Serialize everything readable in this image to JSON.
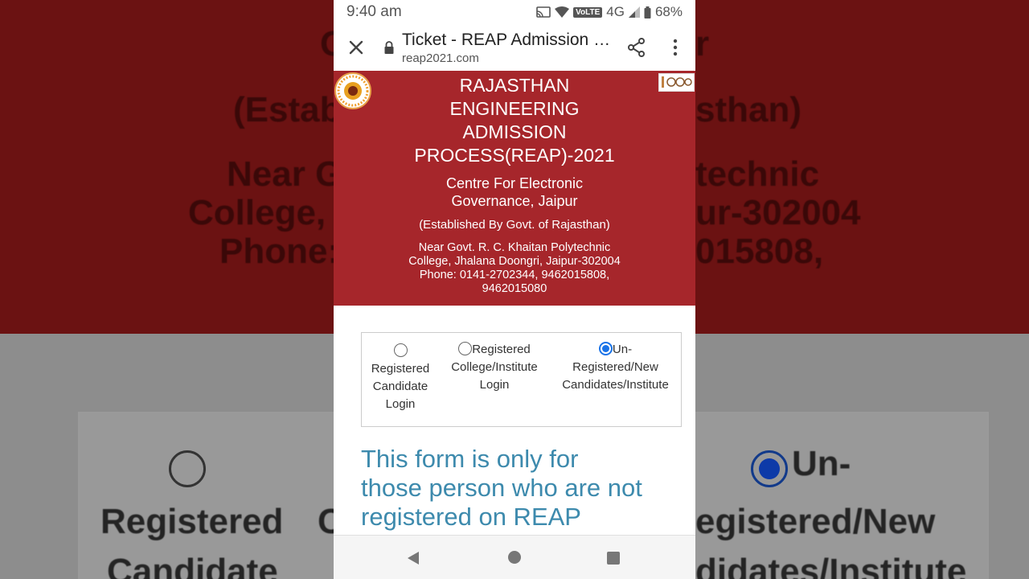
{
  "status_bar": {
    "time": "9:40 am",
    "network": "4G",
    "volte": "VoLTE",
    "battery": "68%"
  },
  "browser": {
    "page_title": "Ticket - REAP Admission Process",
    "url": "reap2021.com"
  },
  "header": {
    "title_lines": [
      "RAJASTHAN",
      "ENGINEERING",
      "ADMISSION",
      "PROCESS(REAP)-2021"
    ],
    "centre_lines": [
      "Centre For Electronic",
      "Governance, Jaipur"
    ],
    "established": "(Established By Govt. of Rajasthan)",
    "address_lines": [
      "Near Govt. R. C. Khaitan Polytechnic",
      "College, Jhalana Doongri, Jaipur-302004",
      "Phone: 0141-2702344, 9462015808,",
      "9462015080"
    ]
  },
  "login_options": [
    {
      "lines": [
        "Registered",
        "Candidate",
        "Login"
      ],
      "selected": false
    },
    {
      "lines": [
        "Registered",
        "College/Institute",
        "Login"
      ],
      "selected": false
    },
    {
      "lines": [
        "Un-",
        "Registered/New",
        "Candidates/Institute"
      ],
      "selected": true
    }
  ],
  "notice_lines": [
    "This form is only for",
    "those person who are not",
    "registered on REAP"
  ],
  "colors": {
    "header_red": "#a6262b",
    "notice_blue": "#3d8aad",
    "radio_blue": "#1a73e8"
  }
}
